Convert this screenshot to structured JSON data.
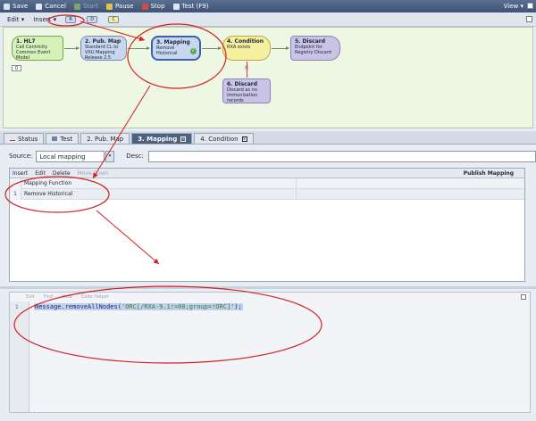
{
  "toolbar": {
    "items": [
      {
        "label": "Save",
        "icon": "save-icon",
        "enabled": true,
        "color": "#d9e3f0"
      },
      {
        "label": "Cancel",
        "icon": "cancel-icon",
        "enabled": true,
        "color": "#e0e6ee"
      },
      {
        "label": "Start",
        "icon": "start-icon",
        "enabled": false,
        "color": "#7fa36b"
      },
      {
        "label": "Pause",
        "icon": "pause-icon",
        "enabled": true,
        "color": "#e2c14a"
      },
      {
        "label": "Stop",
        "icon": "stop-icon",
        "enabled": true,
        "color": "#d24b3e"
      },
      {
        "label": "Test (F9)",
        "icon": "test-icon",
        "enabled": true,
        "color": "#e0e6ee"
      }
    ],
    "view_label": "View"
  },
  "subtoolbar": {
    "edit_label": "Edit",
    "insert_label": "Insert",
    "badges": [
      {
        "label": "R",
        "color": "#cfd8f5"
      },
      {
        "label": "D",
        "color": "#cfd8f5"
      },
      {
        "label": "C",
        "color": "#f5f0a0"
      }
    ]
  },
  "flow": {
    "nodes": [
      {
        "title": "1. HL7",
        "desc": "Call Centricity Common Event Model"
      },
      {
        "title": "2. Pub. Map",
        "desc": "Standard CL to VXU Mapping Release 2.5"
      },
      {
        "title": "3. Mapping",
        "desc": "Remove Historical"
      },
      {
        "title": "4. Condition",
        "desc": "RXA exists"
      },
      {
        "title": "5. Discard",
        "desc": "Endpoint for Registry Discard"
      },
      {
        "title": "6. Discard",
        "desc": "Discard as no immunization records"
      }
    ],
    "zoom_badge": "0"
  },
  "tabs": [
    {
      "label": "Status",
      "active": false
    },
    {
      "label": "Test",
      "active": false
    },
    {
      "label": "2. Pub. Map",
      "active": false
    },
    {
      "label": "3. Mapping",
      "active": true
    },
    {
      "label": "4. Condition",
      "active": false
    }
  ],
  "source": {
    "label": "Source:",
    "value": "Local mapping",
    "desc_label": "Desc:",
    "desc_value": ""
  },
  "mapping": {
    "toolbar": {
      "insert": "Insert",
      "edit": "Edit",
      "delete": "Delete",
      "move": "Move Down",
      "publish": "Publish Mapping"
    },
    "header": "Mapping Function",
    "rows": [
      {
        "index": "1",
        "name": "Remove Historical"
      }
    ]
  },
  "editor": {
    "toolbar": [
      "Edit",
      "Find",
      "View",
      "Code Helper"
    ],
    "line_number": "1",
    "code_prefix": "message.removeAllNodes(",
    "code_string": "'ORC[/RXA-9.1!=00;group=!ORC]'",
    "code_suffix": ");"
  },
  "annotation_color": "#d32020"
}
